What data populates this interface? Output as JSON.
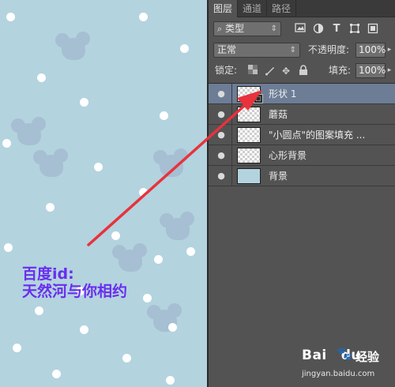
{
  "panel": {
    "tabs": [
      {
        "label": "图层",
        "active": true
      },
      {
        "label": "通道",
        "active": false
      },
      {
        "label": "路径",
        "active": false
      }
    ],
    "filter": {
      "kind_label": "类型",
      "icons": [
        "image-filter-icon",
        "adjustment-filter-icon",
        "type-filter-icon",
        "shape-filter-icon",
        "smart-object-filter-icon"
      ]
    },
    "blend": {
      "mode": "正常",
      "opacity_label": "不透明度:",
      "opacity_value": "100%"
    },
    "lock": {
      "label": "锁定:",
      "icons": [
        "lock-transparent-icon",
        "lock-image-icon",
        "lock-position-icon",
        "lock-all-icon"
      ],
      "fill_label": "填充:",
      "fill_value": "100%"
    },
    "layers": [
      {
        "name": "形状 1",
        "selected": true,
        "visible": true,
        "thumb": "transparent",
        "badge": true
      },
      {
        "name": "蘑菇",
        "selected": false,
        "visible": true,
        "thumb": "transparent",
        "badge": false
      },
      {
        "name": "\"小圆点\"的图案填充 ...",
        "selected": false,
        "visible": true,
        "thumb": "transparent",
        "badge": false
      },
      {
        "name": "心形背景",
        "selected": false,
        "visible": true,
        "thumb": "transparent",
        "badge": false
      },
      {
        "name": "背景",
        "selected": false,
        "visible": true,
        "thumb": "solid",
        "badge": false
      }
    ]
  },
  "canvas": {
    "background": "#b3d3df",
    "watermark": {
      "line1": "百度id:",
      "line2": "天然河与你相约"
    }
  },
  "baidu": {
    "brand": "Bai",
    "brand_tail": "du",
    "product": "经验",
    "url": "jingyan.baidu.com"
  },
  "colors": {
    "panel_bg": "#535353",
    "selected_row": "#6d7d96",
    "arrow": "#e8323c",
    "watermark": "#6a2df0"
  }
}
